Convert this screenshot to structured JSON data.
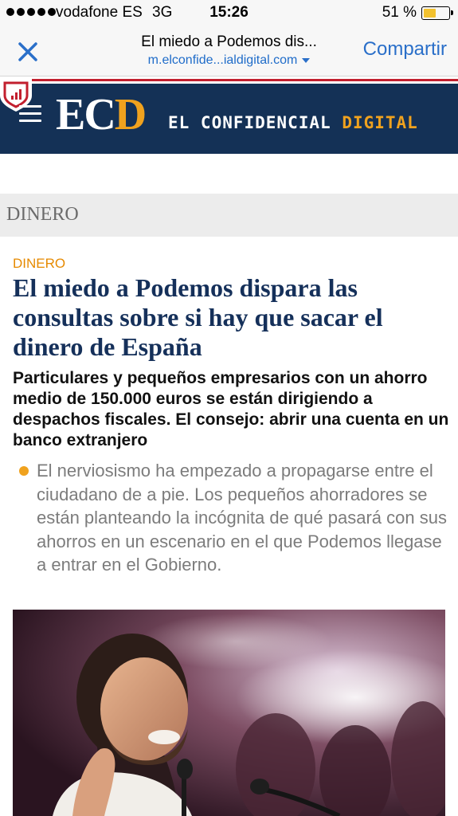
{
  "status_bar": {
    "carrier": "vodafone ES",
    "network": "3G",
    "time": "15:26",
    "battery_percent": "51 %",
    "battery_level": 0.51,
    "signal_bars": 5
  },
  "browser_header": {
    "close_icon": "close-x-icon",
    "page_title": "El miedo a Podemos dis...",
    "url": "m.elconfide...ialdigital.com",
    "share_label": "Compartir",
    "accent_color": "#2a6fc9"
  },
  "site_header": {
    "logo_ec": "EC",
    "logo_d": "D",
    "name_primary": "EL CONFIDENCIAL",
    "name_accent": "DIGITAL",
    "background_color": "#143156",
    "accent_color": "#f0a21e",
    "menu_icon": "hamburger-menu-icon",
    "badge_icon": "shield-badge-icon"
  },
  "section_bar": {
    "label": "DINERO"
  },
  "article": {
    "kicker": "DINERO",
    "headline": "El miedo a Podemos dispara las consultas sobre si hay que sacar el dinero de España",
    "subheadline": "Particulares y pequeños empresarios con un ahorro medio de 150.000 euros se están dirigiendo a despachos fiscales. El consejo: abrir una cuenta en un banco extranjero",
    "summary": "El nerviosismo ha empezado a propagarse entre el ciudadano de a pie. Los pequeños ahorradores se están planteando la incógnita de qué pasará con sus ahorros en un escenario en el que Podemos llegase a entrar en el Gobierno.",
    "photo": "photo of a speaker at a microphone"
  }
}
